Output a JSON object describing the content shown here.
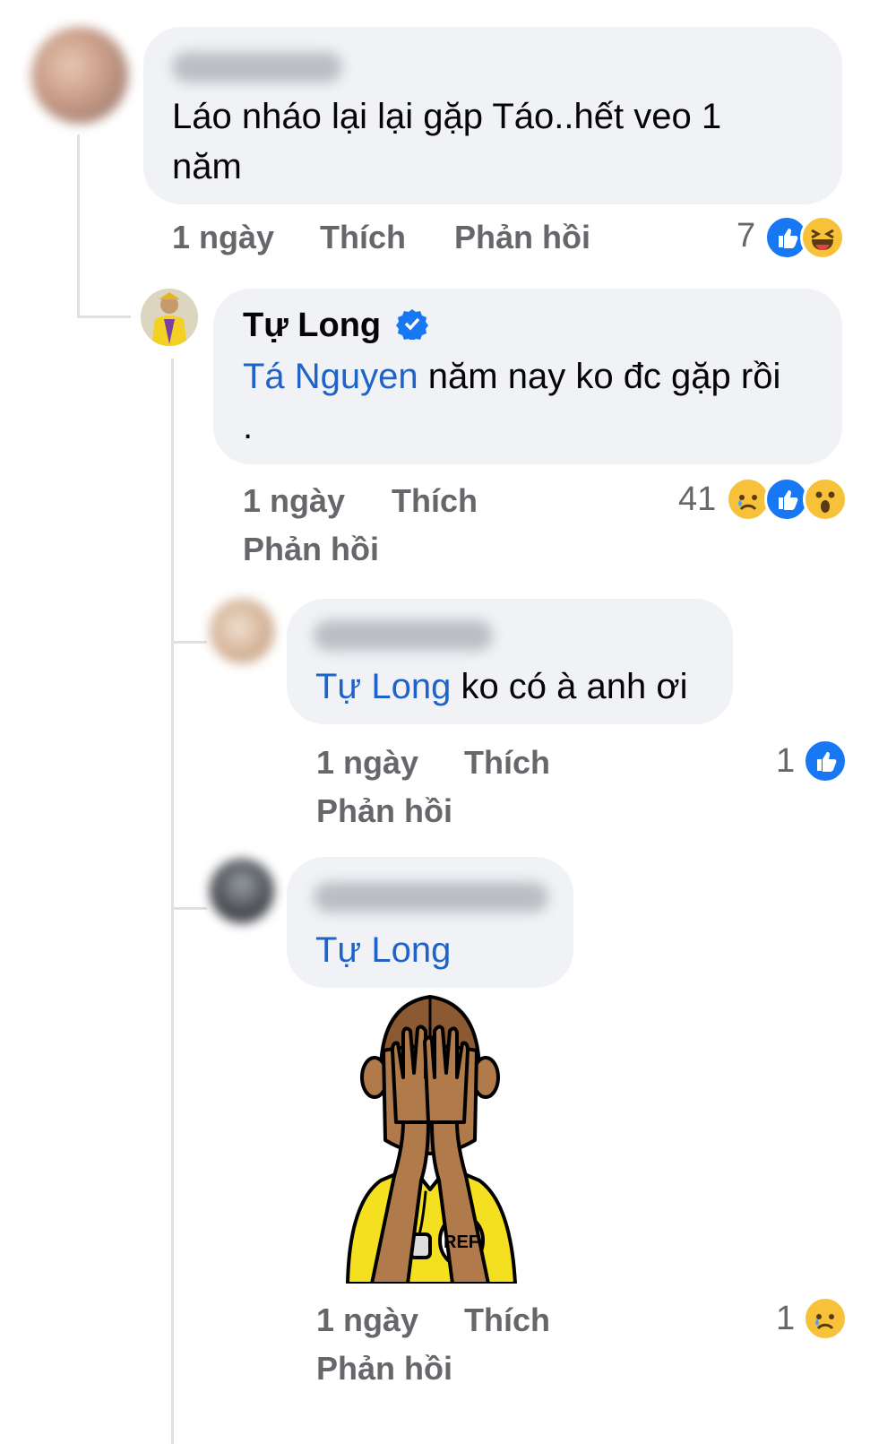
{
  "comments": [
    {
      "text": "Láo nháo lại lại gặp Táo..hết veo 1 năm",
      "time": "1 ngày",
      "like_label": "Thích",
      "reply_label": "Phản hồi",
      "reaction_count": "7",
      "reactions": [
        "like-icon",
        "haha-icon"
      ]
    },
    {
      "author": "Tự Long",
      "verified": true,
      "mention": "Tá Nguyen",
      "text": "năm nay ko đc gặp rồi .",
      "time": "1 ngày",
      "like_label": "Thích",
      "reply_label": "Phản hồi",
      "reaction_count": "41",
      "reactions": [
        "sad-icon",
        "like-icon",
        "wow-icon"
      ]
    },
    {
      "mention": "Tự Long",
      "text": "ko có à anh ơi",
      "time": "1 ngày",
      "like_label": "Thích",
      "reply_label": "Phản hồi",
      "reaction_count": "1",
      "reactions": [
        "like-icon"
      ]
    },
    {
      "mention": "Tự Long",
      "sticker": "referee-covering-eyes-sticker",
      "sticker_text": "REF",
      "time": "1 ngày",
      "like_label": "Thích",
      "reply_label": "Phản hồi",
      "reaction_count": "1",
      "reactions": [
        "sad-icon"
      ]
    }
  ],
  "colors": {
    "bubble": "#f0f2f5",
    "mention": "#1f63c9",
    "meta": "#65676b",
    "like": "#1877f2",
    "emoji": "#f7c13a"
  }
}
